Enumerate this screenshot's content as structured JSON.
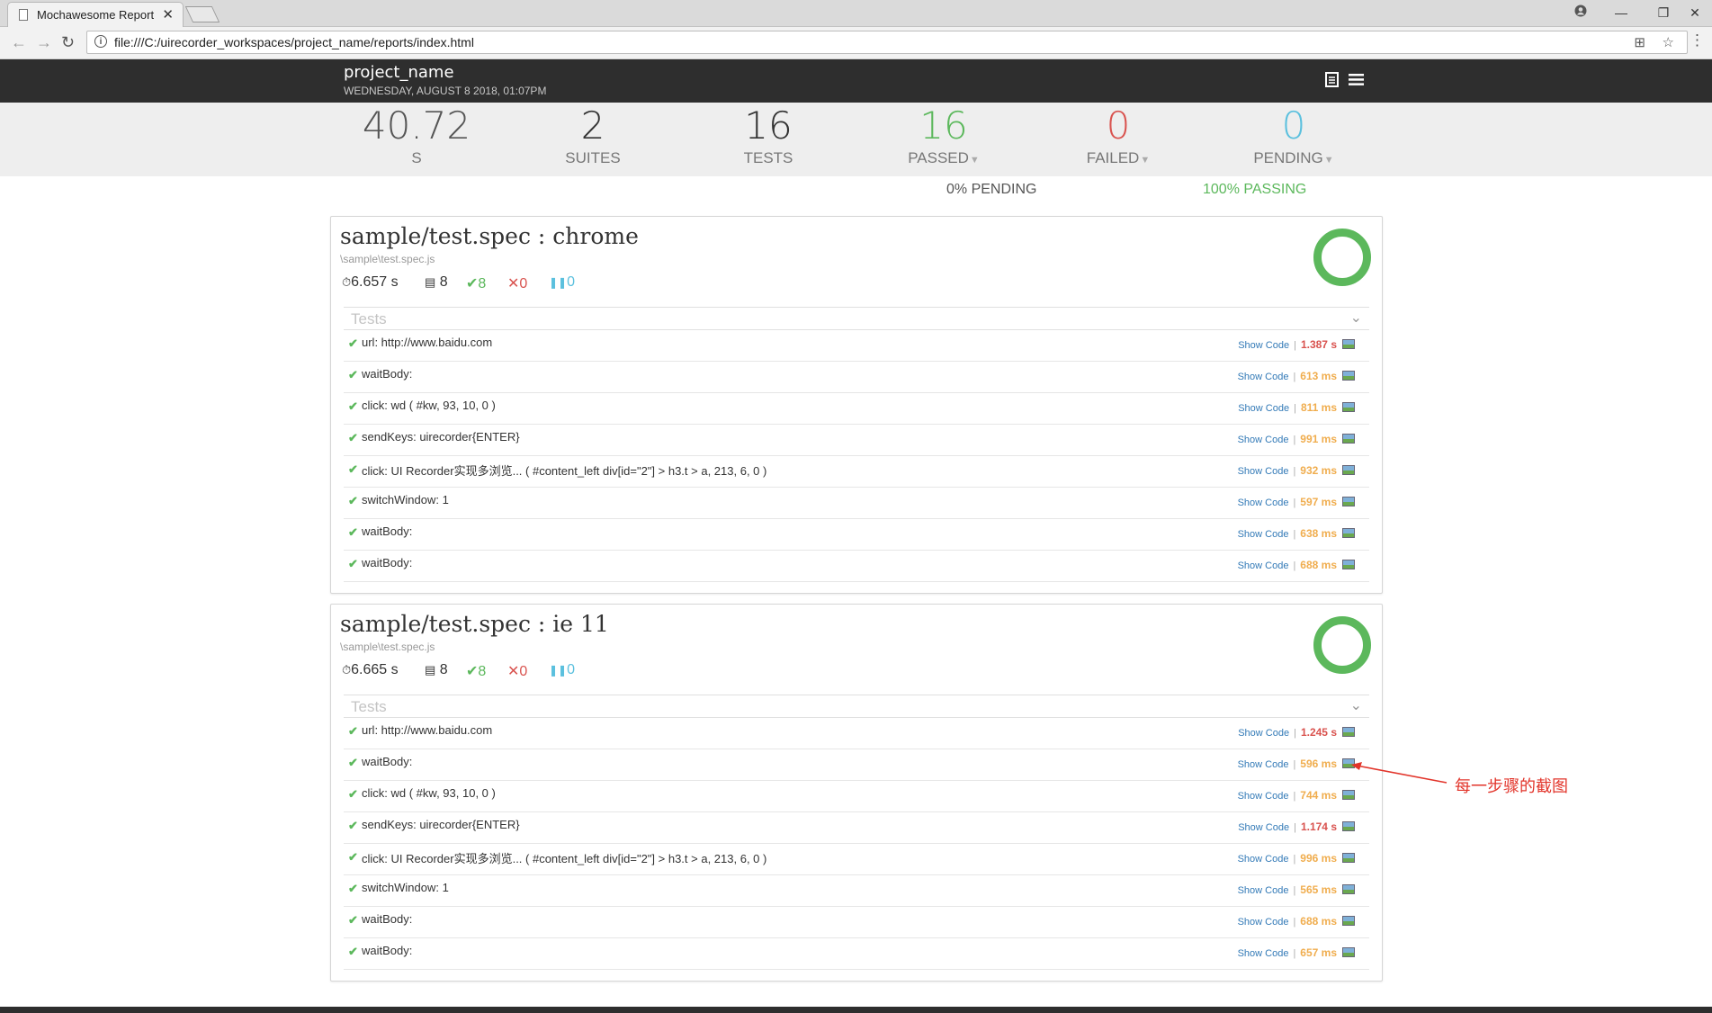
{
  "browser": {
    "tab_title": "Mochawesome Report",
    "tab_close": "✕",
    "url": "file:///C:/uirecorder_workspaces/project_name/reports/index.html",
    "window_controls": [
      "—",
      "❐",
      "✕"
    ],
    "account_icon": "account-icon"
  },
  "report": {
    "project_name": "project_name",
    "date": "WEDNESDAY, AUGUST 8 2018, 01:07PM"
  },
  "summary": {
    "duration": {
      "value": "40.72",
      "label": "S"
    },
    "suites": {
      "value": "2",
      "label": "SUITES"
    },
    "tests": {
      "value": "16",
      "label": "TESTS"
    },
    "passed": {
      "value": "16",
      "label": "PASSED"
    },
    "failed": {
      "value": "0",
      "label": "FAILED"
    },
    "pending": {
      "value": "0",
      "label": "PENDING"
    },
    "pending_pct": "0% PENDING",
    "passing_pct": "100% PASSING"
  },
  "colors": {
    "passed": "#5cb85c",
    "failed": "#d9534f",
    "pending": "#5bc0de",
    "duration_slow": "#d9534f",
    "duration_med": "#f0ad4e"
  },
  "suites": [
    {
      "title": "sample/test.spec : chrome",
      "file": "\\sample\\test.spec.js",
      "duration": "6.657 s",
      "tests": "8",
      "passes": "8",
      "failures": "0",
      "pending": "0",
      "passing_pct": 100,
      "tests_label": "Tests",
      "rows": [
        {
          "name": "url: http://www.baidu.com",
          "duration": "1.387 s",
          "speed": "slow"
        },
        {
          "name": "waitBody:",
          "duration": "613 ms",
          "speed": "med"
        },
        {
          "name": "click: wd ( #kw, 93, 10, 0 )",
          "duration": "811 ms",
          "speed": "med"
        },
        {
          "name": "sendKeys: uirecorder{ENTER}",
          "duration": "991 ms",
          "speed": "med"
        },
        {
          "name": "click: UI Recorder实现多浏览... ( #content_left div[id=\"2\"] > h3.t > a, 213, 6, 0 )",
          "duration": "932 ms",
          "speed": "med"
        },
        {
          "name": "switchWindow: 1",
          "duration": "597 ms",
          "speed": "med"
        },
        {
          "name": "waitBody:",
          "duration": "638 ms",
          "speed": "med"
        },
        {
          "name": "waitBody:",
          "duration": "688 ms",
          "speed": "med"
        }
      ]
    },
    {
      "title": "sample/test.spec : ie 11",
      "file": "\\sample\\test.spec.js",
      "duration": "6.665 s",
      "tests": "8",
      "passes": "8",
      "failures": "0",
      "pending": "0",
      "passing_pct": 100,
      "tests_label": "Tests",
      "rows": [
        {
          "name": "url: http://www.baidu.com",
          "duration": "1.245 s",
          "speed": "slow"
        },
        {
          "name": "waitBody:",
          "duration": "596 ms",
          "speed": "med"
        },
        {
          "name": "click: wd ( #kw, 93, 10, 0 )",
          "duration": "744 ms",
          "speed": "med"
        },
        {
          "name": "sendKeys: uirecorder{ENTER}",
          "duration": "1.174 s",
          "speed": "slow"
        },
        {
          "name": "click: UI Recorder实现多浏览... ( #content_left div[id=\"2\"] > h3.t > a, 213, 6, 0 )",
          "duration": "996 ms",
          "speed": "med"
        },
        {
          "name": "switchWindow: 1",
          "duration": "565 ms",
          "speed": "med"
        },
        {
          "name": "waitBody:",
          "duration": "688 ms",
          "speed": "med"
        },
        {
          "name": "waitBody:",
          "duration": "657 ms",
          "speed": "med"
        }
      ]
    }
  ],
  "row_labels": {
    "show_code": "Show Code",
    "separator": "|"
  },
  "annotation": {
    "text": "每一步骤的截图"
  }
}
